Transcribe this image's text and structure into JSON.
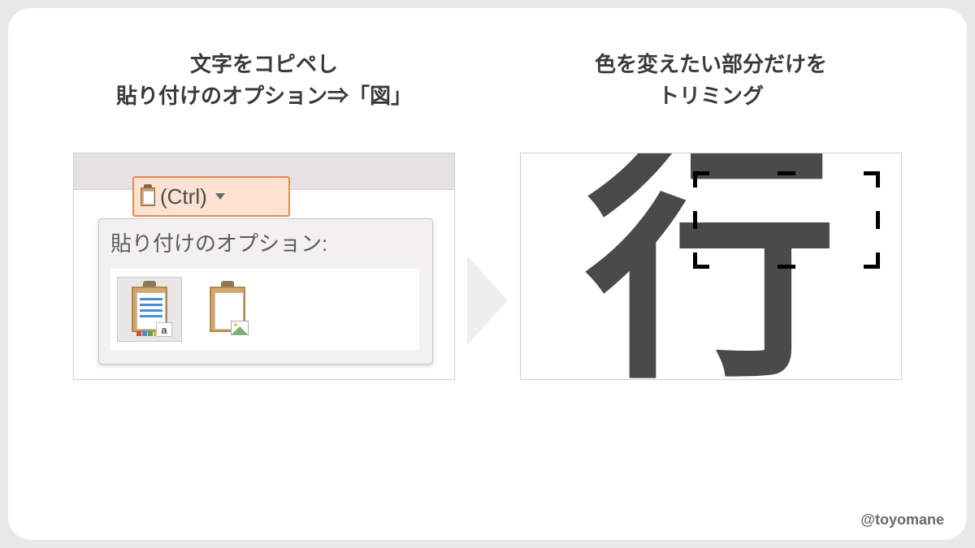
{
  "left": {
    "heading_line1": "文字をコピペし",
    "heading_line2": "貼り付けのオプション⇒「図」",
    "ctrl_label": "(Ctrl)",
    "popup_title": "貼り付けのオプション:",
    "badge_letter": "a"
  },
  "right": {
    "heading_line1": "色を変えたい部分だけを",
    "heading_line2": "トリミング",
    "glyph": "行"
  },
  "watermark": "@toyomane"
}
